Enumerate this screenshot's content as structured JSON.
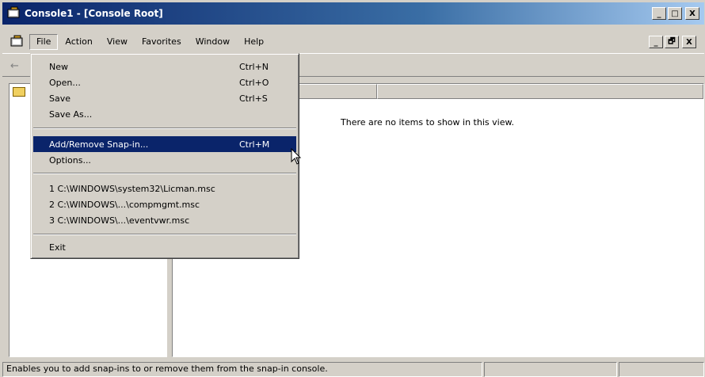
{
  "window": {
    "title": "Console1 - [Console Root]",
    "buttons": {
      "minimize": "_",
      "maximize": "□",
      "close": "X",
      "restore": "🗗"
    }
  },
  "menubar": {
    "items": [
      "File",
      "Action",
      "View",
      "Favorites",
      "Window",
      "Help"
    ],
    "accelerators": [
      "F",
      "A",
      "V",
      "o",
      "W",
      "H"
    ]
  },
  "file_menu": {
    "items": [
      {
        "label": "New",
        "shortcut": "Ctrl+N"
      },
      {
        "label": "Open...",
        "shortcut": "Ctrl+O"
      },
      {
        "label": "Save",
        "shortcut": "Ctrl+S"
      },
      {
        "label": "Save As...",
        "shortcut": ""
      },
      {
        "label": "Add/Remove Snap-in...",
        "shortcut": "Ctrl+M"
      },
      {
        "label": "Options...",
        "shortcut": ""
      },
      {
        "label": "1 C:\\WINDOWS\\system32\\Licman.msc",
        "shortcut": ""
      },
      {
        "label": "2 C:\\WINDOWS\\...\\compmgmt.msc",
        "shortcut": ""
      },
      {
        "label": "3 C:\\WINDOWS\\...\\eventvwr.msc",
        "shortcut": ""
      },
      {
        "label": "Exit",
        "shortcut": ""
      }
    ],
    "selected_index": 4
  },
  "right_pane": {
    "empty_message": "There are no items to show in this view."
  },
  "statusbar": {
    "text": "Enables you to add snap-ins to or remove them from the snap-in console."
  },
  "colors": {
    "titlebar_start": "#0a246a",
    "titlebar_end": "#a6caf0",
    "selection": "#0a246a",
    "face": "#d4d0c8"
  },
  "icons": {
    "app": "mmc-console-icon",
    "back": "back-arrow-icon",
    "folder": "folder-icon"
  }
}
